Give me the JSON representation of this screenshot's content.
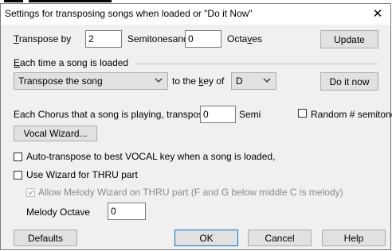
{
  "dialog": {
    "title": "Settings for transposing songs when loaded or \"Do it Now\"",
    "close_glyph": "✕"
  },
  "transpose": {
    "label": "Transpose by",
    "semitones_value": "2",
    "semitones_label": "Semitonesand",
    "octaves_value": "0",
    "octaves_label": "Octaves",
    "update_button": "Update"
  },
  "on_load": {
    "group_label": "Each time a song is loaded",
    "action_select": "Transpose the song",
    "to_key_label": "to the key of",
    "key_select": "D",
    "do_it_now_button": "Do it now"
  },
  "chorus": {
    "label": "Each Chorus that a song is playing, transpose by",
    "value": "0",
    "unit": "Semi",
    "random_label": "Random # semitones",
    "random_checked": false
  },
  "vocal_wizard_button": "Vocal Wizard...",
  "options": {
    "auto_transpose_label": "Auto-transpose to best VOCAL key when a song is loaded,",
    "auto_transpose_checked": false,
    "use_wizard_label": "Use Wizard for THRU part",
    "use_wizard_checked": false,
    "allow_melody_label": "Allow Melody Wizard on THRU part (F and G below middle C is melody)",
    "allow_melody_checked": true,
    "allow_melody_enabled": false,
    "melody_octave_label": "Melody Octave",
    "melody_octave_value": "0"
  },
  "footer": {
    "defaults": "Defaults",
    "ok": "OK",
    "cancel": "Cancel",
    "help": "Help"
  },
  "colors": {
    "dialog_bg": "#f0f0f0",
    "button_bg": "#e1e1e1",
    "default_button_border": "#0078d7"
  }
}
